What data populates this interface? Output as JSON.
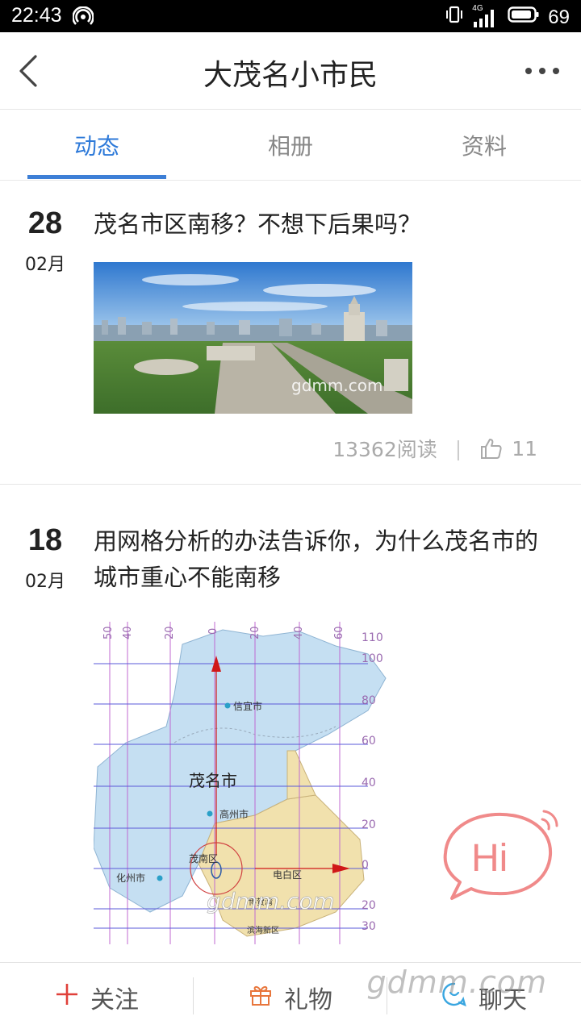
{
  "status_bar": {
    "time": "22:43",
    "network": "4G",
    "battery": "69"
  },
  "header": {
    "title": "大茂名小市民"
  },
  "tabs": [
    {
      "label": "动态",
      "active": true
    },
    {
      "label": "相册",
      "active": false
    },
    {
      "label": "资料",
      "active": false
    }
  ],
  "posts": [
    {
      "day": "28",
      "month": "02月",
      "title": "茂名市区南移？不想下后果吗？",
      "image_watermark": "gdmm.com",
      "reads": "13362阅读",
      "likes": "11"
    },
    {
      "day": "18",
      "month": "02月",
      "title": "用网格分析的办法告诉你，为什么茂名市的城市重心不能南移",
      "map": {
        "title": "茂名市",
        "places": [
          "信宜市",
          "高州市",
          "化州市",
          "茂南区",
          "电白区",
          "滨海新区",
          "博贺湾"
        ],
        "top_ticks": [
          "50",
          "40",
          "20",
          "0",
          "20",
          "40",
          "60"
        ],
        "right_ticks": [
          "110",
          "100",
          "80",
          "60",
          "40",
          "20",
          "0",
          "20",
          "30"
        ],
        "watermark": "gdmm.com"
      }
    }
  ],
  "chat_bubble": {
    "label": "Hi"
  },
  "bottom_bar": {
    "follow": "关注",
    "gift": "礼物",
    "chat": "聊天"
  },
  "watermark": "gdmm.com",
  "colors": {
    "accent": "#3d7fd6",
    "follow_red": "#e0403a",
    "gift_orange": "#e8763c",
    "chat_blue": "#3aa6e0",
    "hi_pink": "#f08a8a"
  }
}
